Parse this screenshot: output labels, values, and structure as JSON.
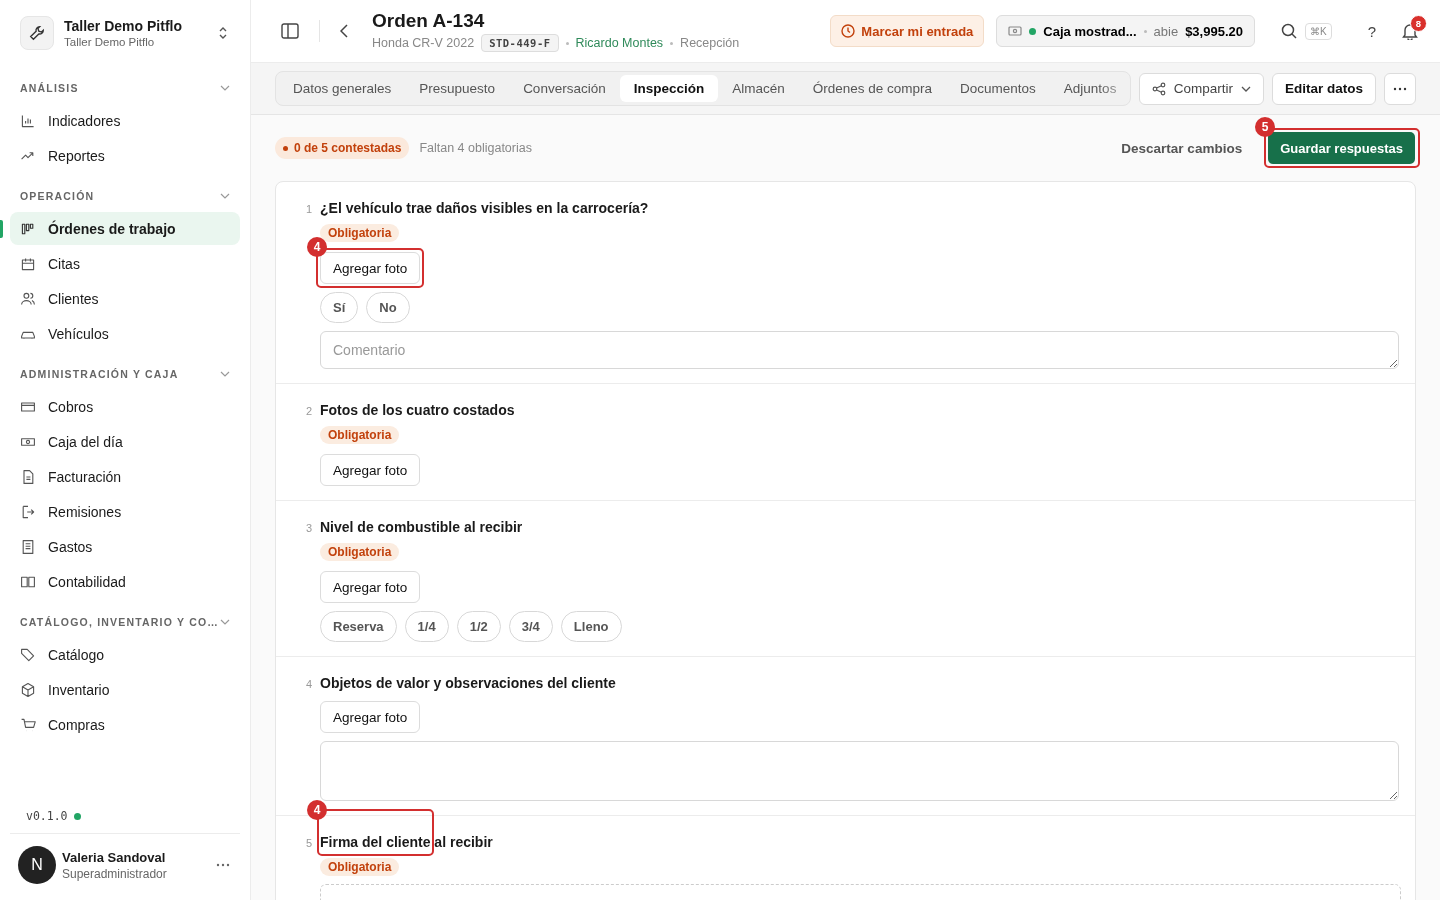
{
  "workspace": {
    "name": "Taller Demo Pitflo",
    "subtitle": "Taller Demo Pitflo"
  },
  "sidebar": {
    "sections": [
      {
        "title": "ANÁLISIS",
        "items": [
          {
            "label": "Indicadores",
            "selected": false
          },
          {
            "label": "Reportes",
            "selected": false
          }
        ]
      },
      {
        "title": "OPERACIÓN",
        "items": [
          {
            "label": "Órdenes de trabajo",
            "selected": true
          },
          {
            "label": "Citas",
            "selected": false
          },
          {
            "label": "Clientes",
            "selected": false
          },
          {
            "label": "Vehículos",
            "selected": false
          }
        ]
      },
      {
        "title": "ADMINISTRACIÓN Y CAJA",
        "items": [
          {
            "label": "Cobros",
            "selected": false
          },
          {
            "label": "Caja del día",
            "selected": false
          },
          {
            "label": "Facturación",
            "selected": false
          },
          {
            "label": "Remisiones",
            "selected": false
          },
          {
            "label": "Gastos",
            "selected": false
          },
          {
            "label": "Contabilidad",
            "selected": false
          }
        ]
      },
      {
        "title": "CATÁLOGO, INVENTARIO Y CO…",
        "items": [
          {
            "label": "Catálogo",
            "selected": false
          },
          {
            "label": "Inventario",
            "selected": false
          },
          {
            "label": "Compras",
            "selected": false
          }
        ]
      }
    ],
    "version": "v0.1.0",
    "user": {
      "initial": "N",
      "name": "Valeria Sandoval",
      "role": "Superadministrador"
    }
  },
  "header": {
    "title": "Orden A-134",
    "vehicle": "Honda CR-V 2022",
    "plate": "STD-449-F",
    "advisor": "Ricardo Montes",
    "stage": "Recepción",
    "clock_in": "Marcar mi entrada",
    "register": {
      "name": "Caja mostrad...",
      "status": "abie",
      "amount": "$3,995.20"
    },
    "shortcut": "⌘K",
    "help": "?",
    "notifications": "8"
  },
  "tabs": [
    {
      "label": "Datos generales",
      "selected": false
    },
    {
      "label": "Presupuesto",
      "selected": false
    },
    {
      "label": "Conversación",
      "selected": false
    },
    {
      "label": "Inspección",
      "selected": true
    },
    {
      "label": "Almacén",
      "selected": false
    },
    {
      "label": "Órdenes de compra",
      "selected": false
    },
    {
      "label": "Documentos",
      "selected": false
    },
    {
      "label": "Adjuntos",
      "selected": false
    }
  ],
  "actions": {
    "share": "Compartir",
    "edit": "Editar datos"
  },
  "progress": {
    "answered": "0 de 5 contestadas",
    "missing": "Faltan 4 obligatorias",
    "discard": "Descartar cambios",
    "save": "Guardar respuestas",
    "save_callout": "5"
  },
  "questions": [
    {
      "number": "1",
      "title": "¿El vehículo trae daños visibles en la carrocería?",
      "badge": "Obligatoria",
      "photo": "Agregar foto",
      "photo_callout": "4",
      "options": [
        {
          "label": "Sí",
          "selected": false
        },
        {
          "label": "No",
          "selected": false
        }
      ],
      "field": {
        "kind": "comment",
        "placeholder": "Comentario"
      }
    },
    {
      "number": "2",
      "title": "Fotos de los cuatro costados",
      "badge": "Obligatoria",
      "photo": "Agregar foto"
    },
    {
      "number": "3",
      "title": "Nivel de combustible al recibir",
      "badge": "Obligatoria",
      "photo": "Agregar foto",
      "options": [
        {
          "label": "Reserva",
          "selected": false
        },
        {
          "label": "1/4",
          "selected": false
        },
        {
          "label": "1/2",
          "selected": false
        },
        {
          "label": "3/4",
          "selected": false
        },
        {
          "label": "Lleno",
          "selected": false
        }
      ]
    },
    {
      "number": "4",
      "title": "Objetos de valor y observaciones del cliente",
      "photo": "Agregar foto",
      "field": {
        "kind": "textarea"
      }
    },
    {
      "number": "5",
      "title": "Firma del cliente al recibir",
      "title_callout": "4",
      "badge": "Obligatoria",
      "field": {
        "kind": "signature"
      }
    }
  ]
}
